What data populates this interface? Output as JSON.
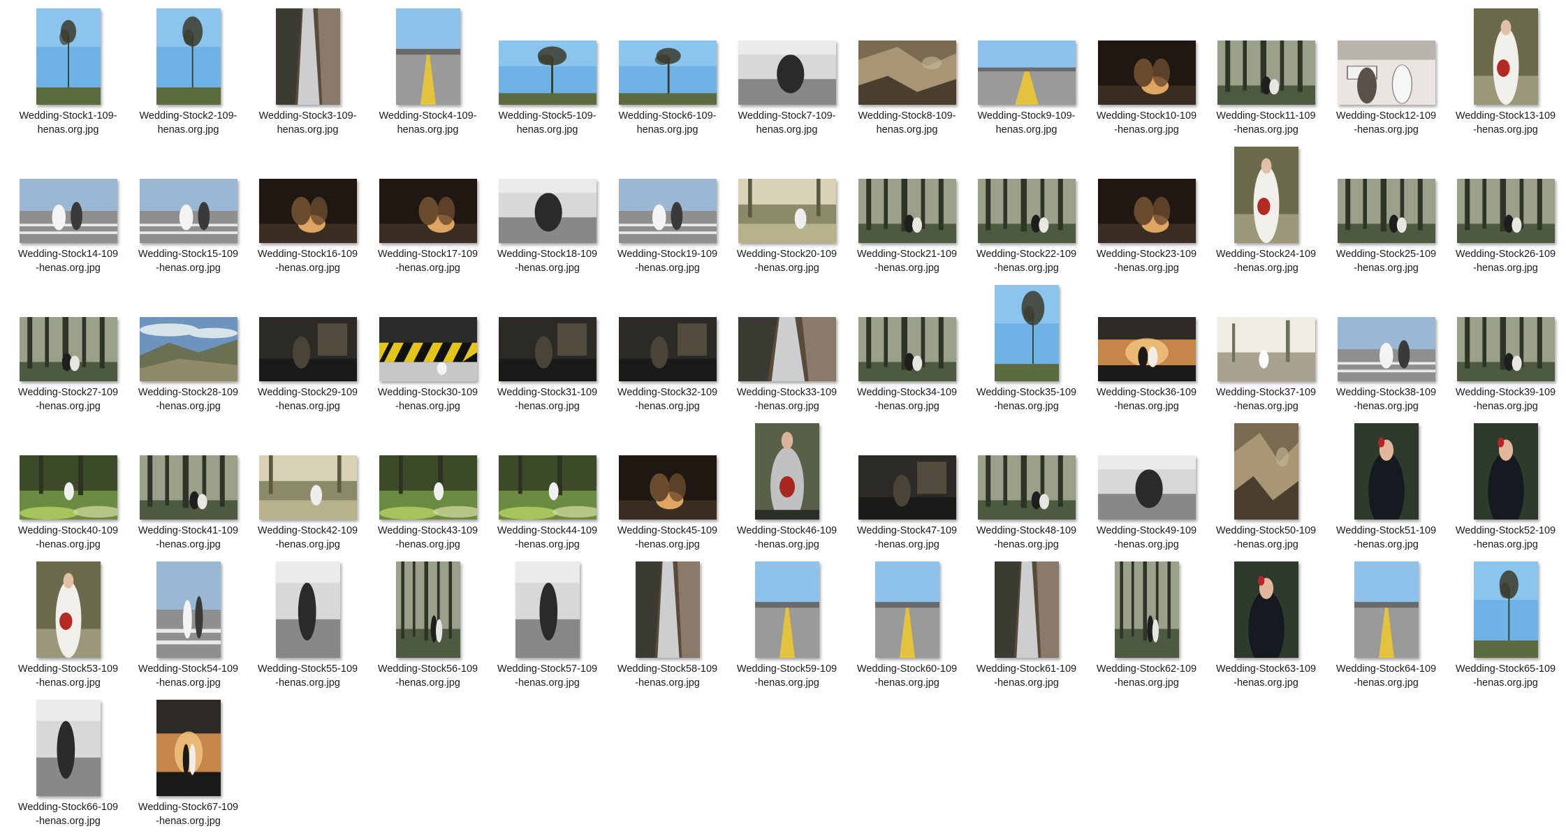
{
  "window": {
    "view": "Large icons"
  },
  "files": [
    {
      "l1": "Wedding-Stock1-109-",
      "l2": "henas.org.jpg",
      "o": "p",
      "s": "sky"
    },
    {
      "l1": "Wedding-Stock2-109-",
      "l2": "henas.org.jpg",
      "o": "p",
      "s": "sky"
    },
    {
      "l1": "Wedding-Stock3-109-",
      "l2": "henas.org.jpg",
      "o": "p",
      "s": "falls"
    },
    {
      "l1": "Wedding-Stock4-109-",
      "l2": "henas.org.jpg",
      "o": "p",
      "s": "road"
    },
    {
      "l1": "Wedding-Stock5-109-",
      "l2": "henas.org.jpg",
      "o": "l",
      "s": "sky"
    },
    {
      "l1": "Wedding-Stock6-109-",
      "l2": "henas.org.jpg",
      "o": "l",
      "s": "sky"
    },
    {
      "l1": "Wedding-Stock7-109-",
      "l2": "henas.org.jpg",
      "o": "l",
      "s": "bw"
    },
    {
      "l1": "Wedding-Stock8-109-",
      "l2": "henas.org.jpg",
      "o": "l",
      "s": "rock"
    },
    {
      "l1": "Wedding-Stock9-109-",
      "l2": "henas.org.jpg",
      "o": "l",
      "s": "road"
    },
    {
      "l1": "Wedding-Stock10-109",
      "l2": "-henas.org.jpg",
      "o": "l",
      "s": "night"
    },
    {
      "l1": "Wedding-Stock11-109",
      "l2": "-henas.org.jpg",
      "o": "l",
      "s": "forest"
    },
    {
      "l1": "Wedding-Stock12-109",
      "l2": "-henas.org.jpg",
      "o": "l",
      "s": "city"
    },
    {
      "l1": "Wedding-Stock13-109",
      "l2": "-henas.org.jpg",
      "o": "p",
      "s": "bride"
    },
    {
      "l1": "Wedding-Stock14-109",
      "l2": "-henas.org.jpg",
      "o": "l",
      "s": "street"
    },
    {
      "l1": "Wedding-Stock15-109",
      "l2": "-henas.org.jpg",
      "o": "l",
      "s": "street"
    },
    {
      "l1": "Wedding-Stock16-109",
      "l2": "-henas.org.jpg",
      "o": "l",
      "s": "night"
    },
    {
      "l1": "Wedding-Stock17-109",
      "l2": "-henas.org.jpg",
      "o": "l",
      "s": "night"
    },
    {
      "l1": "Wedding-Stock18-109",
      "l2": "-henas.org.jpg",
      "o": "l",
      "s": "bw"
    },
    {
      "l1": "Wedding-Stock19-109",
      "l2": "-henas.org.jpg",
      "o": "l",
      "s": "street"
    },
    {
      "l1": "Wedding-Stock20-109",
      "l2": "-henas.org.jpg",
      "o": "l",
      "s": "field"
    },
    {
      "l1": "Wedding-Stock21-109",
      "l2": "-henas.org.jpg",
      "o": "l",
      "s": "forest"
    },
    {
      "l1": "Wedding-Stock22-109",
      "l2": "-henas.org.jpg",
      "o": "l",
      "s": "forest"
    },
    {
      "l1": "Wedding-Stock23-109",
      "l2": "-henas.org.jpg",
      "o": "l",
      "s": "night"
    },
    {
      "l1": "Wedding-Stock24-109",
      "l2": "-henas.org.jpg",
      "o": "p",
      "s": "bride"
    },
    {
      "l1": "Wedding-Stock25-109",
      "l2": "-henas.org.jpg",
      "o": "l",
      "s": "forest"
    },
    {
      "l1": "Wedding-Stock26-109",
      "l2": "-henas.org.jpg",
      "o": "l",
      "s": "forest"
    },
    {
      "l1": "Wedding-Stock27-109",
      "l2": "-henas.org.jpg",
      "o": "l",
      "s": "forest"
    },
    {
      "l1": "Wedding-Stock28-109",
      "l2": "-henas.org.jpg",
      "o": "l",
      "s": "mountain"
    },
    {
      "l1": "Wedding-Stock29-109",
      "l2": "-henas.org.jpg",
      "o": "l",
      "s": "dark"
    },
    {
      "l1": "Wedding-Stock30-109",
      "l2": "-henas.org.jpg",
      "o": "l",
      "s": "stripes"
    },
    {
      "l1": "Wedding-Stock31-109",
      "l2": "-henas.org.jpg",
      "o": "l",
      "s": "dark"
    },
    {
      "l1": "Wedding-Stock32-109",
      "l2": "-henas.org.jpg",
      "o": "l",
      "s": "dark"
    },
    {
      "l1": "Wedding-Stock33-109",
      "l2": "-henas.org.jpg",
      "o": "l",
      "s": "falls"
    },
    {
      "l1": "Wedding-Stock34-109",
      "l2": "-henas.org.jpg",
      "o": "l",
      "s": "forest"
    },
    {
      "l1": "Wedding-Stock35-109",
      "l2": "-henas.org.jpg",
      "o": "p",
      "s": "sky"
    },
    {
      "l1": "Wedding-Stock36-109",
      "l2": "-henas.org.jpg",
      "o": "l",
      "s": "sunset"
    },
    {
      "l1": "Wedding-Stock37-109",
      "l2": "-henas.org.jpg",
      "o": "l",
      "s": "haze"
    },
    {
      "l1": "Wedding-Stock38-109",
      "l2": "-henas.org.jpg",
      "o": "l",
      "s": "street"
    },
    {
      "l1": "Wedding-Stock39-109",
      "l2": "-henas.org.jpg",
      "o": "l",
      "s": "forest"
    },
    {
      "l1": "Wedding-Stock40-109",
      "l2": "-henas.org.jpg",
      "o": "l",
      "s": "green"
    },
    {
      "l1": "Wedding-Stock41-109",
      "l2": "-henas.org.jpg",
      "o": "l",
      "s": "forest"
    },
    {
      "l1": "Wedding-Stock42-109",
      "l2": "-henas.org.jpg",
      "o": "l",
      "s": "field"
    },
    {
      "l1": "Wedding-Stock43-109",
      "l2": "-henas.org.jpg",
      "o": "l",
      "s": "green"
    },
    {
      "l1": "Wedding-Stock44-109",
      "l2": "-henas.org.jpg",
      "o": "l",
      "s": "green"
    },
    {
      "l1": "Wedding-Stock45-109",
      "l2": "-henas.org.jpg",
      "o": "l",
      "s": "night"
    },
    {
      "l1": "Wedding-Stock46-109",
      "l2": "-henas.org.jpg",
      "o": "p",
      "s": "groom"
    },
    {
      "l1": "Wedding-Stock47-109",
      "l2": "-henas.org.jpg",
      "o": "l",
      "s": "dark"
    },
    {
      "l1": "Wedding-Stock48-109",
      "l2": "-henas.org.jpg",
      "o": "l",
      "s": "forest"
    },
    {
      "l1": "Wedding-Stock49-109",
      "l2": "-henas.org.jpg",
      "o": "l",
      "s": "bw"
    },
    {
      "l1": "Wedding-Stock50-109",
      "l2": "-henas.org.jpg",
      "o": "p",
      "s": "rock"
    },
    {
      "l1": "Wedding-Stock51-109",
      "l2": "-henas.org.jpg",
      "o": "p",
      "s": "portrait"
    },
    {
      "l1": "Wedding-Stock52-109",
      "l2": "-henas.org.jpg",
      "o": "p",
      "s": "portrait"
    },
    {
      "l1": "Wedding-Stock53-109",
      "l2": "-henas.org.jpg",
      "o": "p",
      "s": "bride"
    },
    {
      "l1": "Wedding-Stock54-109",
      "l2": "-henas.org.jpg",
      "o": "p",
      "s": "street"
    },
    {
      "l1": "Wedding-Stock55-109",
      "l2": "-henas.org.jpg",
      "o": "p",
      "s": "bw"
    },
    {
      "l1": "Wedding-Stock56-109",
      "l2": "-henas.org.jpg",
      "o": "p",
      "s": "forest"
    },
    {
      "l1": "Wedding-Stock57-109",
      "l2": "-henas.org.jpg",
      "o": "p",
      "s": "bw"
    },
    {
      "l1": "Wedding-Stock58-109",
      "l2": "-henas.org.jpg",
      "o": "p",
      "s": "falls"
    },
    {
      "l1": "Wedding-Stock59-109",
      "l2": "-henas.org.jpg",
      "o": "p",
      "s": "road"
    },
    {
      "l1": "Wedding-Stock60-109",
      "l2": "-henas.org.jpg",
      "o": "p",
      "s": "road"
    },
    {
      "l1": "Wedding-Stock61-109",
      "l2": "-henas.org.jpg",
      "o": "p",
      "s": "falls"
    },
    {
      "l1": "Wedding-Stock62-109",
      "l2": "-henas.org.jpg",
      "o": "p",
      "s": "forest"
    },
    {
      "l1": "Wedding-Stock63-109",
      "l2": "-henas.org.jpg",
      "o": "p",
      "s": "portrait"
    },
    {
      "l1": "Wedding-Stock64-109",
      "l2": "-henas.org.jpg",
      "o": "p",
      "s": "road"
    },
    {
      "l1": "Wedding-Stock65-109",
      "l2": "-henas.org.jpg",
      "o": "p",
      "s": "sky"
    },
    {
      "l1": "Wedding-Stock66-109",
      "l2": "-henas.org.jpg",
      "o": "p",
      "s": "bw"
    },
    {
      "l1": "Wedding-Stock67-109",
      "l2": "-henas.org.jpg",
      "o": "p",
      "s": "sunset"
    }
  ],
  "palettes": {
    "sky": [
      "#6fb3e6",
      "#9fd0f2",
      "#5b6b3f",
      "#3a3a2a"
    ],
    "falls": [
      "#5a4a3a",
      "#d8dde0",
      "#3b3b34",
      "#8a7a6a"
    ],
    "road": [
      "#8ec2ea",
      "#9a9a9a",
      "#e3c23e",
      "#6a6a6a"
    ],
    "bw": [
      "#d8d8d8",
      "#888888",
      "#2a2a2a",
      "#f4f4f4"
    ],
    "rock": [
      "#7b6a50",
      "#a89674",
      "#4a3e2e",
      "#c9b99a"
    ],
    "night": [
      "#1e1712",
      "#6b4b2e",
      "#f1b36a",
      "#3a2e22"
    ],
    "forest": [
      "#4e5a40",
      "#6f7a5e",
      "#2f3526",
      "#9aa08a"
    ],
    "city": [
      "#b9b4ad",
      "#e9e6e2",
      "#5a524a",
      "#8c857c"
    ],
    "bride": [
      "#6b6b4b",
      "#f0efea",
      "#b22a22",
      "#9a9878"
    ],
    "street": [
      "#9ab7d3",
      "#8f8f8f",
      "#e9e9e9",
      "#3a3a3a"
    ],
    "field": [
      "#8a8a68",
      "#b7b28c",
      "#5a5a40",
      "#d9d2b6"
    ],
    "mountain": [
      "#6d94bf",
      "#d9e3ea",
      "#6a7052",
      "#8f8a6a"
    ],
    "dark": [
      "#2c2a25",
      "#4a4438",
      "#1a1a18",
      "#6d6450"
    ],
    "stripes": [
      "#2a2a2a",
      "#e4c51d",
      "#111111",
      "#c8c8c8"
    ],
    "sunset": [
      "#2e2a26",
      "#c6864a",
      "#f0c27c",
      "#1b1a18"
    ],
    "haze": [
      "#d8d3c8",
      "#a8a290",
      "#6f705c",
      "#efece4"
    ],
    "green": [
      "#6b8a42",
      "#a7c45c",
      "#3c4a2a",
      "#d6e0a2"
    ],
    "groom": [
      "#596048",
      "#bfc1c2",
      "#a8281f",
      "#2c2f27"
    ],
    "portrait": [
      "#2e3b2c",
      "#141a1f",
      "#b8232a",
      "#e2b69c"
    ]
  }
}
